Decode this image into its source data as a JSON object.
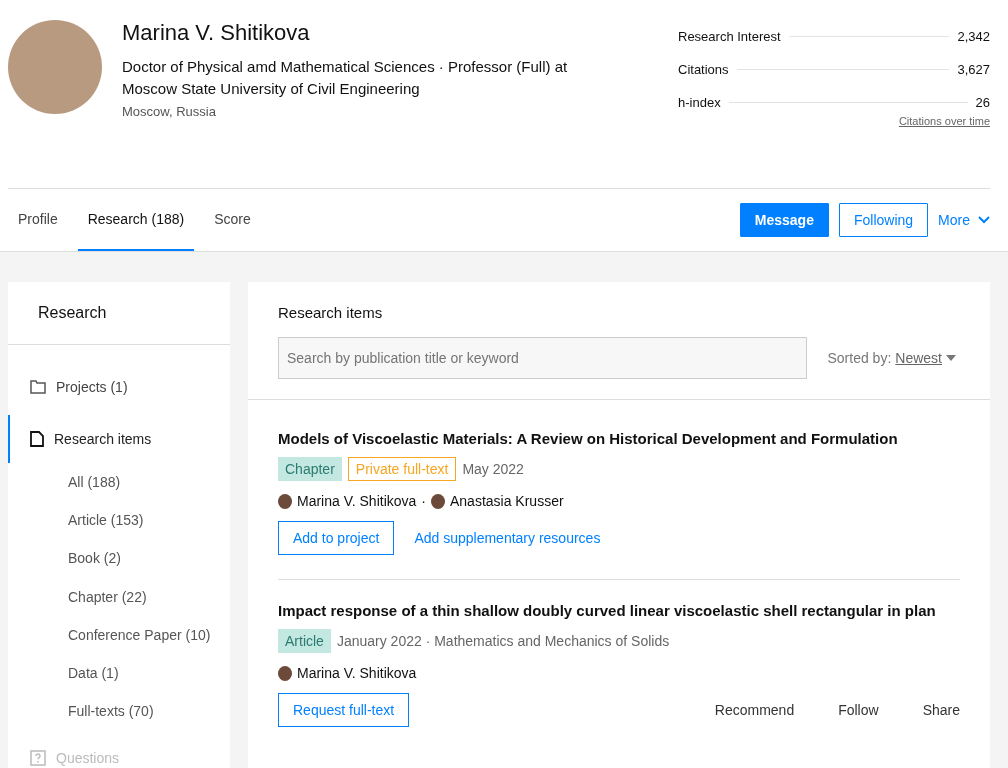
{
  "profile": {
    "name": "Marina V. Shitikova",
    "position": "Doctor of Physical amd Mathematical Sciences · Professor (Full) at Moscow State University of Civil Engineering",
    "location": "Moscow, Russia"
  },
  "stats": [
    {
      "label": "Research Interest",
      "value": "2,342"
    },
    {
      "label": "Citations",
      "value": "3,627"
    },
    {
      "label": "h-index",
      "value": "26"
    }
  ],
  "stats_link": "Citations over time",
  "tabs": [
    {
      "label": "Profile",
      "selected": false
    },
    {
      "label": "Research (188)",
      "selected": true
    },
    {
      "label": "Score",
      "selected": false
    }
  ],
  "header_buttons": [
    {
      "label": "Message",
      "kind": "primary"
    },
    {
      "label": "Following",
      "kind": "outline"
    },
    {
      "label": "More",
      "kind": "dropdown"
    }
  ],
  "sidebar": {
    "title": "Research",
    "items": [
      {
        "label": "Projects (1)",
        "kind": "folder",
        "selected": false,
        "disabled": false
      },
      {
        "label": "Research items",
        "kind": "document",
        "selected": true,
        "disabled": false,
        "children": [
          {
            "label": "All (188)"
          },
          {
            "label": "Article (153)"
          },
          {
            "label": "Book (2)"
          },
          {
            "label": "Chapter (22)"
          },
          {
            "label": "Conference Paper (10)"
          },
          {
            "label": "Data (1)"
          },
          {
            "label": "Full-texts (70)"
          }
        ]
      },
      {
        "label": "Questions",
        "kind": "question",
        "selected": false,
        "disabled": true
      }
    ]
  },
  "main": {
    "title": "Research items",
    "search": {
      "placeholder": "Search by publication title or keyword"
    },
    "sort_label": "Sorted by:",
    "sort_value": "Newest"
  },
  "publications": [
    {
      "title": "Models of Viscoelastic Materials: A Review on Historical Development and Formulation",
      "tags": [
        {
          "label": "Chapter",
          "kind": "type"
        },
        {
          "label": "Private full-text",
          "kind": "access"
        }
      ],
      "meta": "May 2022",
      "author_separator": "·",
      "authors": [
        "Marina V. Shitikova",
        "Anastasia Krusser"
      ],
      "actions": [
        {
          "label": "Add to project",
          "kind": "outline"
        },
        {
          "label": "Add supplementary resources",
          "kind": "link"
        }
      ]
    },
    {
      "title": "Impact response of a thin shallow doubly curved linear viscoelastic shell rectangular in plan",
      "tags": [
        {
          "label": "Article",
          "kind": "type"
        }
      ],
      "meta": "January 2022 · Mathematics and Mechanics of Solids",
      "authors": [
        "Marina V. Shitikova"
      ],
      "actions": [
        {
          "label": "Request full-text",
          "kind": "outline"
        }
      ],
      "secondary_actions": [
        "Recommend",
        "Follow",
        "Share"
      ]
    }
  ]
}
